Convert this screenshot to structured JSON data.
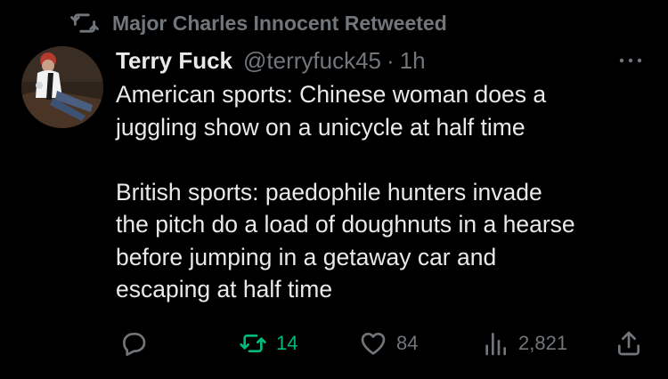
{
  "retweet_context": {
    "icon": "retweet-icon",
    "text": "Major Charles Innocent Retweeted"
  },
  "tweet": {
    "author": {
      "display_name": "Terry Fuck",
      "handle": "@terryfuck45",
      "avatar": "avatar-photo"
    },
    "separator": "·",
    "time": "1h",
    "more_icon": "more-horizontal-icon",
    "text_lines": [
      "American sports: Chinese woman does a",
      "juggling show on a unicycle at half time",
      "",
      "British sports: paedophile hunters invade",
      "the pitch do a load of doughnuts in a hearse",
      "before jumping in a getaway car and",
      "escaping at half time"
    ]
  },
  "actions": {
    "reply": {
      "icon": "reply-icon",
      "count": ""
    },
    "retweet": {
      "icon": "retweet-icon",
      "count": "14",
      "active": true
    },
    "like": {
      "icon": "heart-icon",
      "count": "84"
    },
    "views": {
      "icon": "views-icon",
      "count": "2,821"
    },
    "share": {
      "icon": "share-icon"
    }
  },
  "colors": {
    "background": "#000000",
    "primary_text": "#e7e9ea",
    "secondary_text": "#71767b",
    "retweet_active": "#00ba7c"
  }
}
